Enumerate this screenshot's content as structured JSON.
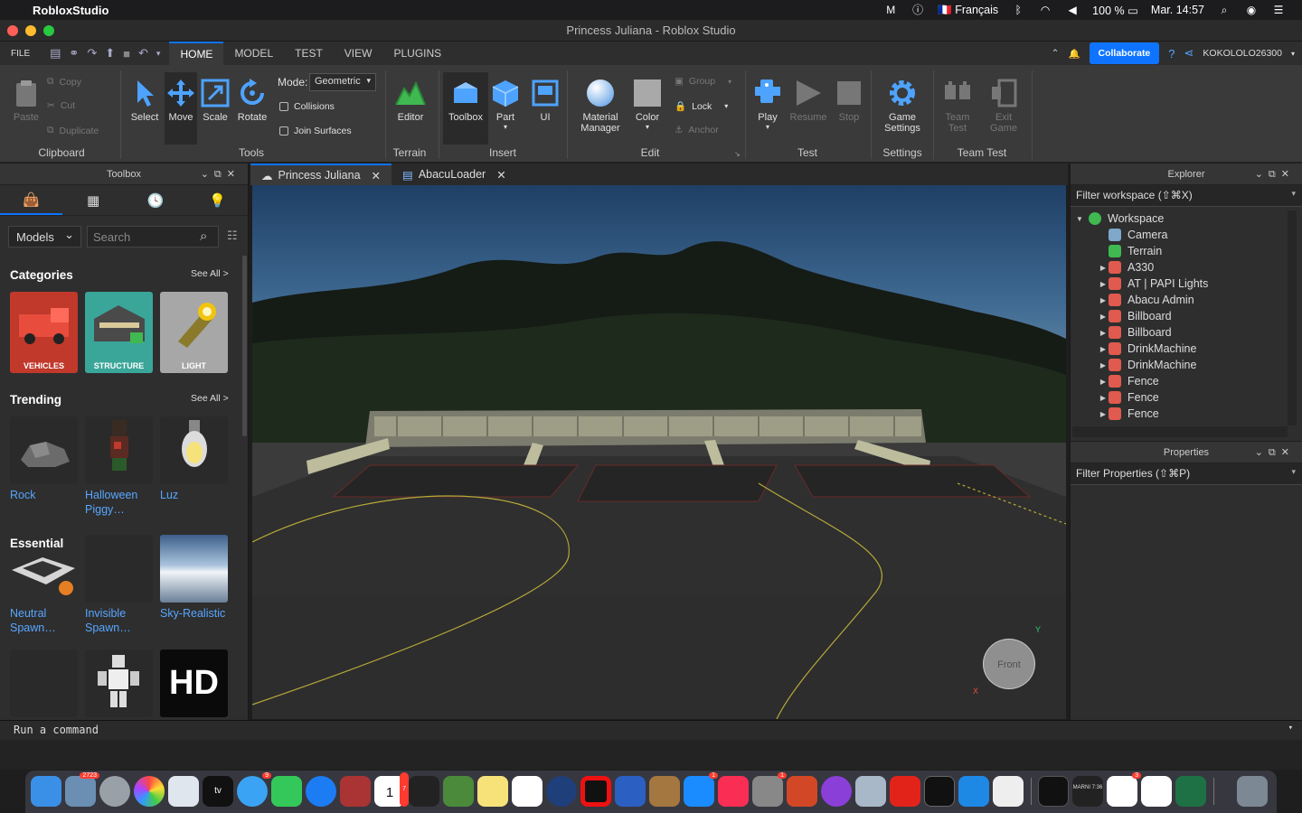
{
  "menubar": {
    "app_name": "RobloxStudio",
    "language": "Français",
    "battery": "100 %",
    "clock": "Mar. 14:57"
  },
  "window": {
    "title": "Princess Juliana - Roblox Studio"
  },
  "ribbon_tabs": {
    "file": "FILE",
    "tabs": [
      "HOME",
      "MODEL",
      "TEST",
      "VIEW",
      "PLUGINS"
    ],
    "active": "HOME",
    "collaborate": "Collaborate",
    "username": "KOKOLOLO26300"
  },
  "ribbon": {
    "clipboard": {
      "paste": "Paste",
      "copy": "Copy",
      "cut": "Cut",
      "duplicate": "Duplicate",
      "group_label": "Clipboard"
    },
    "tools": {
      "select": "Select",
      "move": "Move",
      "scale": "Scale",
      "rotate": "Rotate",
      "mode_label": "Mode:",
      "mode_value": "Geometric",
      "collisions": "Collisions",
      "join_surfaces": "Join Surfaces",
      "group_label": "Tools"
    },
    "terrain": {
      "editor": "Editor",
      "group_label": "Terrain"
    },
    "insert": {
      "toolbox": "Toolbox",
      "part": "Part",
      "ui": "UI",
      "group_label": "Insert"
    },
    "edit": {
      "material_manager": "Material Manager",
      "color": "Color",
      "group": "Group",
      "lock": "Lock",
      "anchor": "Anchor",
      "group_label": "Edit"
    },
    "test": {
      "play": "Play",
      "resume": "Resume",
      "stop": "Stop",
      "group_label": "Test"
    },
    "settings": {
      "game_settings": "Game Settings",
      "group_label": "Settings"
    },
    "team_test": {
      "team_test": "Team Test",
      "exit_game": "Exit Game",
      "group_label": "Team Test"
    }
  },
  "toolbox": {
    "title": "Toolbox",
    "category_select": "Models",
    "search_placeholder": "Search",
    "categories_heading": "Categories",
    "see_all": "See All >",
    "categories": [
      "VEHICLES",
      "STRUCTURE",
      "LIGHT"
    ],
    "trending_heading": "Trending",
    "trending": [
      "Rock",
      "Halloween Piggy…",
      "Luz"
    ],
    "essential_heading": "Essential",
    "essential": [
      "Neutral Spawn…",
      "Invisible Spawn…",
      "Sky-Realistic"
    ],
    "more_hd": "HD"
  },
  "doc_tabs": [
    "Princess Juliana",
    "AbacuLoader"
  ],
  "viewport": {
    "view_cube_label": "Front",
    "axis_y": "Y",
    "axis_x": "X"
  },
  "explorer": {
    "title": "Explorer",
    "filter_placeholder": "Filter workspace (⇧⌘X)",
    "items": [
      "Workspace",
      "Camera",
      "Terrain",
      "A330",
      "AT | PAPI Lights",
      "Abacu Admin",
      "Billboard",
      "Billboard",
      "DrinkMachine",
      "DrinkMachine",
      "Fence",
      "Fence",
      "Fence"
    ]
  },
  "properties": {
    "title": "Properties",
    "filter_placeholder": "Filter Properties (⇧⌘P)"
  },
  "command_bar": {
    "placeholder": "Run a command"
  },
  "dock": {
    "badges": {
      "calendar_mail": "2723",
      "messages": "9",
      "calendar": "7",
      "appstore": "1",
      "sysprefs": "1",
      "other": "3"
    },
    "calendar_day": "1",
    "marnier_text": "MARNI 7:36"
  },
  "colors": {
    "accent": "#0e74ff",
    "link": "#58a6ff"
  }
}
